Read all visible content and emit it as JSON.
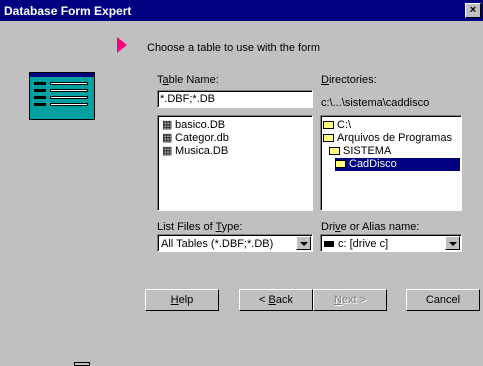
{
  "window": {
    "title": "Database Form Expert",
    "close_glyph": "×"
  },
  "instruction": "Choose a table to use with the form",
  "table_name": {
    "label_pre": "T",
    "label_u": "a",
    "label_post": "ble Name:",
    "value": "*.DBF;*.DB"
  },
  "directories": {
    "label_pre": "",
    "label_u": "D",
    "label_post": "irectories:",
    "current_path": "c:\\...\\sistema\\caddisco"
  },
  "files": [
    {
      "name": "basico.DB",
      "icon": "table-icon"
    },
    {
      "name": "Categor.db",
      "icon": "table-icon"
    },
    {
      "name": "Musica.DB",
      "icon": "table-icon"
    }
  ],
  "dir_tree": [
    {
      "name": "C:\\",
      "icon": "folder-open-icon",
      "selected": false
    },
    {
      "name": "Arquivos de Programas",
      "icon": "folder-open-icon",
      "selected": false
    },
    {
      "name": "SISTEMA",
      "icon": "folder-open-icon",
      "selected": false
    },
    {
      "name": "CadDisco",
      "icon": "folder-open-icon",
      "selected": true
    }
  ],
  "file_type": {
    "label_pre": "List Files of ",
    "label_u": "T",
    "label_post": "ype:",
    "value": "All Tables (*.DBF;*.DB)"
  },
  "drive": {
    "label_pre": "Dri",
    "label_u": "v",
    "label_post": "e or Alias name:",
    "value": "c: [drive c]",
    "icon": "drive-icon"
  },
  "buttons": {
    "help": {
      "pre": "",
      "u": "H",
      "post": "elp"
    },
    "back": {
      "pre": "< ",
      "u": "B",
      "post": "ack"
    },
    "next": {
      "pre": "",
      "u": "N",
      "post": "ext >"
    },
    "cancel": {
      "label": "Cancel"
    }
  },
  "colors": {
    "titlebar": "#000080",
    "step_arrow": "#ff0080",
    "selection": "#000080",
    "preview_bg": "#00a0a0"
  }
}
